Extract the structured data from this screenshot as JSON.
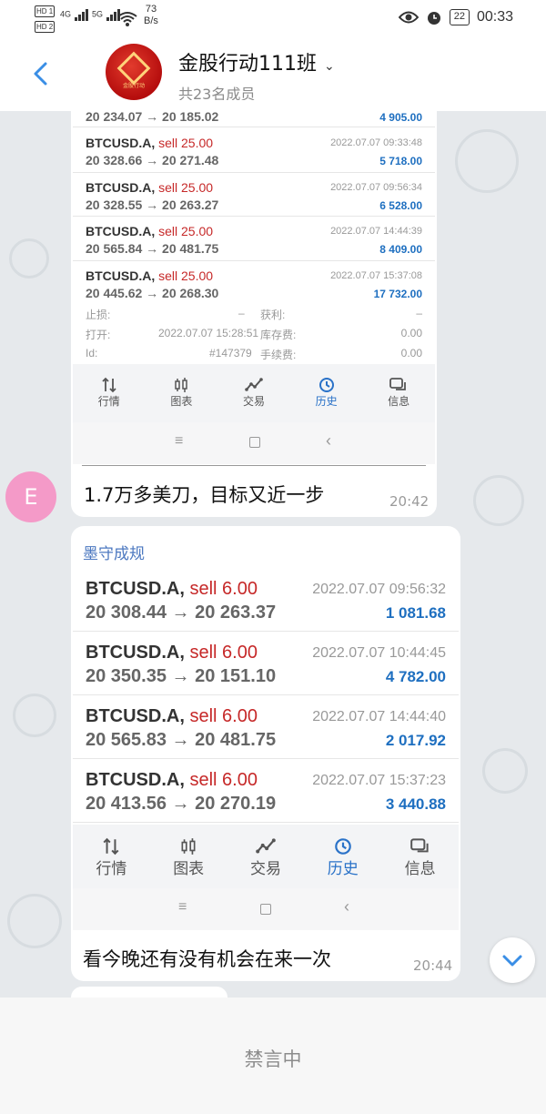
{
  "status_bar": {
    "hd1": "HD 1",
    "hd2": "HD 2",
    "net1": "4G",
    "net2": "5G",
    "speed_value": "73",
    "speed_unit": "B/s",
    "battery": "22",
    "time": "00:33"
  },
  "header": {
    "group_name": "金股行动111班",
    "member_count": "共23名成员",
    "avatar_text": "金股行动"
  },
  "message1": {
    "trades": [
      {
        "prices": "20 234.07 → 20 185.02",
        "profit": "4 905.00"
      },
      {
        "symbol": "BTCUSD.A,",
        "action": "sell 25.00",
        "prices": "20 328.66 → 20 271.48",
        "date": "2022.07.07 09:33:48",
        "profit": "5 718.00"
      },
      {
        "symbol": "BTCUSD.A,",
        "action": "sell 25.00",
        "prices": "20 328.55 → 20 263.27",
        "date": "2022.07.07 09:56:34",
        "profit": "6 528.00"
      },
      {
        "symbol": "BTCUSD.A,",
        "action": "sell 25.00",
        "prices": "20 565.84 → 20 481.75",
        "date": "2022.07.07 14:44:39",
        "profit": "8 409.00"
      },
      {
        "symbol": "BTCUSD.A,",
        "action": "sell 25.00",
        "prices": "20 445.62 → 20 268.30",
        "date": "2022.07.07 15:37:08",
        "profit": "17 732.00"
      }
    ],
    "details": {
      "stop_loss_label": "止损:",
      "stop_loss_value": "–",
      "take_profit_label": "获利:",
      "take_profit_value": "–",
      "open_label": "打开:",
      "open_value": "2022.07.07 15:28:51",
      "swap_label": "库存费:",
      "swap_value": "0.00",
      "id_label": "Id:",
      "id_value": "#147379",
      "fee_label": "手续费:",
      "fee_value": "0.00"
    },
    "tabs": [
      "行情",
      "图表",
      "交易",
      "历史",
      "信息"
    ],
    "text": "1.7万多美刀，目标又近一步",
    "time": "20:42",
    "sender_initial": "E"
  },
  "message2": {
    "sender": "墨守成规",
    "trades": [
      {
        "symbol": "BTCUSD.A,",
        "action": "sell 6.00",
        "prices": "20 308.44 → 20 263.37",
        "date": "2022.07.07 09:56:32",
        "profit": "1 081.68"
      },
      {
        "symbol": "BTCUSD.A,",
        "action": "sell 6.00",
        "prices": "20 350.35 → 20 151.10",
        "date": "2022.07.07 10:44:45",
        "profit": "4 782.00"
      },
      {
        "symbol": "BTCUSD.A,",
        "action": "sell 6.00",
        "prices": "20 565.83 → 20 481.75",
        "date": "2022.07.07 14:44:40",
        "profit": "2 017.92"
      },
      {
        "symbol": "BTCUSD.A,",
        "action": "sell 6.00",
        "prices": "20 413.56 → 20 270.19",
        "date": "2022.07.07 15:37:23",
        "profit": "3 440.88"
      }
    ],
    "tabs": [
      "行情",
      "图表",
      "交易",
      "历史",
      "信息"
    ],
    "text": "看今晚还有没有机会在来一次",
    "time": "20:44"
  },
  "footer": {
    "muted_label": "禁言中"
  },
  "colors": {
    "accent": "#2a72c8",
    "sell": "#c62828",
    "profit": "#1e6fc0",
    "sender": "#4c78c0"
  }
}
